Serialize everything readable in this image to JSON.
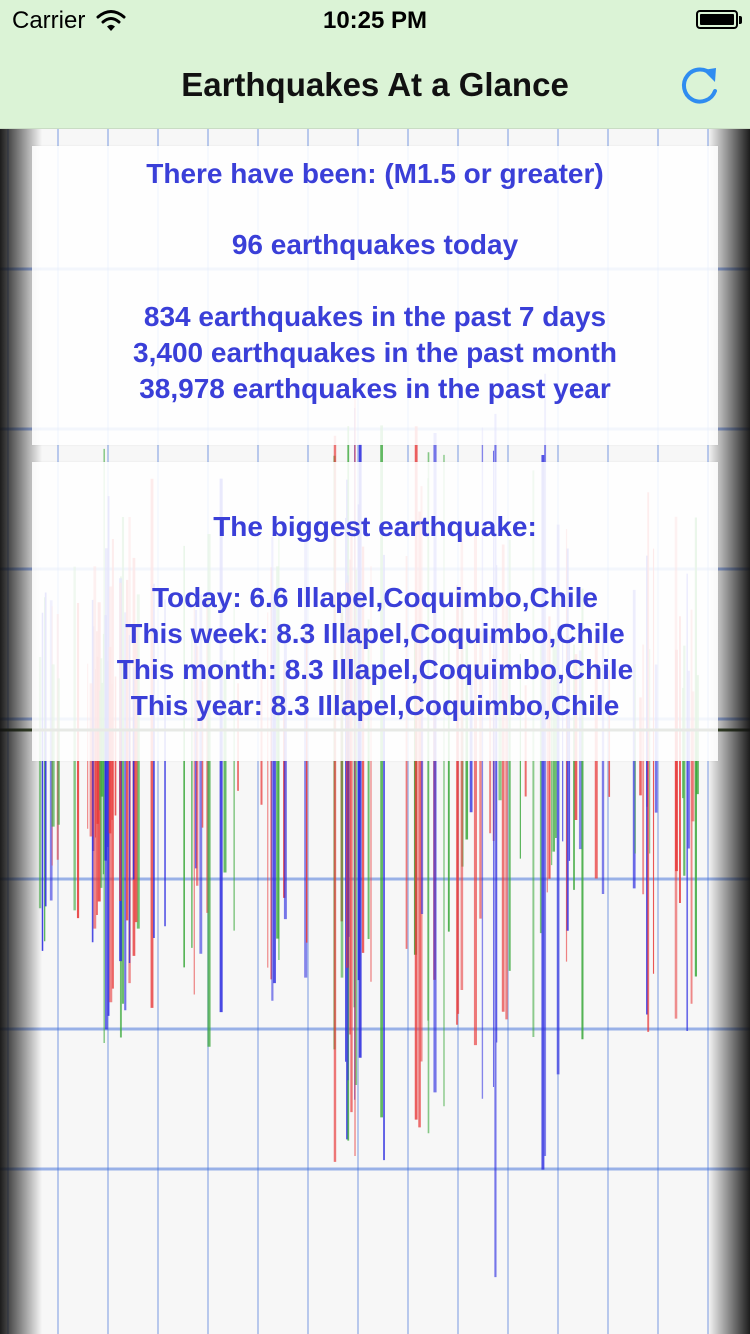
{
  "status_bar": {
    "carrier": "Carrier",
    "time": "10:25 PM"
  },
  "nav": {
    "title": "Earthquakes At a Glance",
    "refresh_icon": "refresh-icon",
    "accent": "#2f8cf0"
  },
  "counts": {
    "header": "There have been: (M1.5 or greater)",
    "today": "96 earthquakes today",
    "week": "834 earthquakes in the past 7 days",
    "month": "3,400 earthquakes in the past month",
    "year": "38,978 earthquakes in the past year"
  },
  "biggest": {
    "header": "The biggest earthquake:",
    "today": "Today: 6.6 Illapel,Coquimbo,Chile",
    "week": "This week: 8.3 Illapel,Coquimbo,Chile",
    "month": "This month: 8.3 Illapel,Coquimbo,Chile",
    "year": "This year: 8.3 Illapel,Coquimbo,Chile"
  },
  "colors": {
    "bar_background": "#dbf3d6",
    "card_text": "#3a3fd8",
    "trace_red": "#e83a3a",
    "trace_green": "#3aa83a",
    "trace_blue": "#2a2ae0",
    "grid_blue": "#3c6cd8"
  }
}
